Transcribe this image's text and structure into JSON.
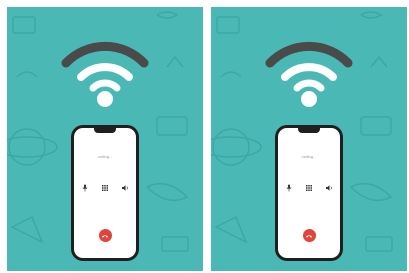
{
  "colors": {
    "background": "#4ab8b4",
    "doodle": "#3fa7a3",
    "wifi_active": "#ffffff",
    "wifi_inactive": "#4a4a4a",
    "phone_frame": "#1f1f1f",
    "end_call": "#e0443a"
  },
  "panels": [
    {
      "wifi_bars_active": 2,
      "wifi_bars_total": 3,
      "call_status": "calling...",
      "controls": [
        "mic-icon",
        "keypad-icon",
        "speaker-icon"
      ],
      "end_call_icon": "phone-hangup-icon"
    },
    {
      "wifi_bars_active": 2,
      "wifi_bars_total": 3,
      "call_status": "calling...",
      "controls": [
        "mic-icon",
        "keypad-icon",
        "speaker-icon"
      ],
      "end_call_icon": "phone-hangup-icon"
    }
  ]
}
